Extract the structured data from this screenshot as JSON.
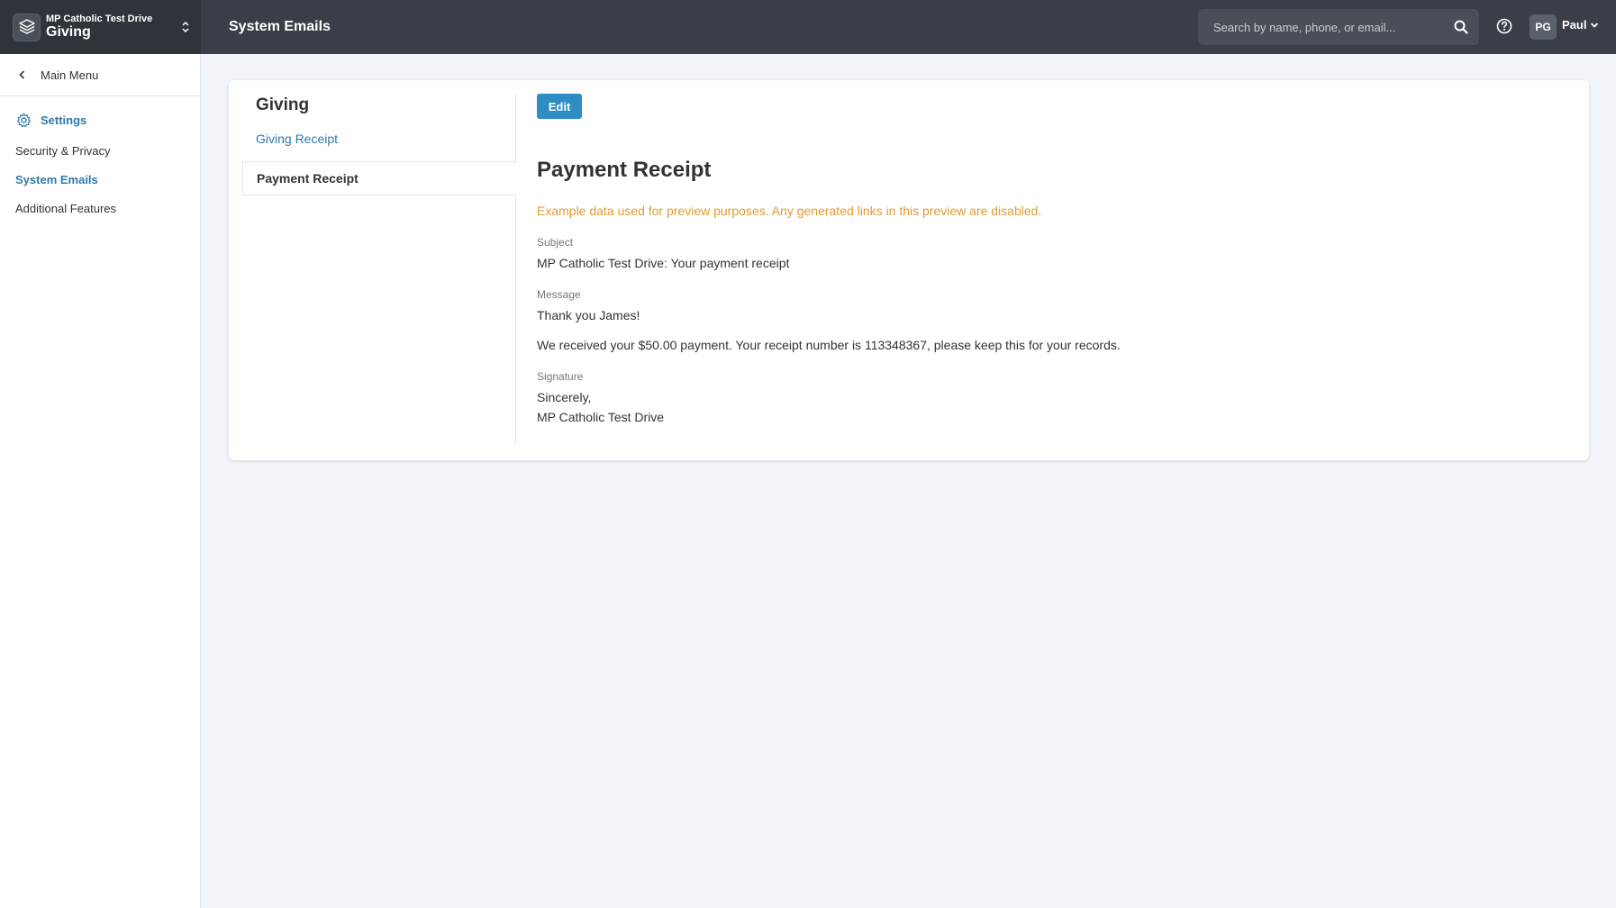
{
  "header": {
    "org_name": "MP Catholic Test Drive",
    "app_name": "Giving",
    "page_title": "System Emails",
    "search_placeholder": "Search by name, phone, or email...",
    "avatar_initials": "PG",
    "user_name": "Paul"
  },
  "sidebar": {
    "back_label": "Main Menu",
    "section_label": "Settings",
    "items": [
      {
        "label": "Security & Privacy",
        "active": false
      },
      {
        "label": "System Emails",
        "active": true
      },
      {
        "label": "Additional Features",
        "active": false
      }
    ]
  },
  "email_list": {
    "title": "Giving",
    "items": [
      {
        "label": "Giving Receipt",
        "active": false
      },
      {
        "label": "Payment Receipt",
        "active": true
      }
    ]
  },
  "preview": {
    "edit_label": "Edit",
    "title": "Payment Receipt",
    "note": "Example data used for preview purposes. Any generated links in this preview are disabled.",
    "subject_label": "Subject",
    "subject": "MP Catholic Test Drive: Your payment receipt",
    "message_label": "Message",
    "message_line1": "Thank you James!",
    "message_line2": "We received your $50.00 payment. Your receipt number is 113348367, please keep this for your records.",
    "signature_label": "Signature",
    "signature_line1": "Sincerely,",
    "signature_line2": "MP Catholic Test Drive"
  },
  "colors": {
    "topbar": "#3a3f47",
    "accent": "#2f79a8",
    "button": "#2f8dc4",
    "warning_text": "#e29a2f",
    "page_bg": "#f1f4f9"
  }
}
